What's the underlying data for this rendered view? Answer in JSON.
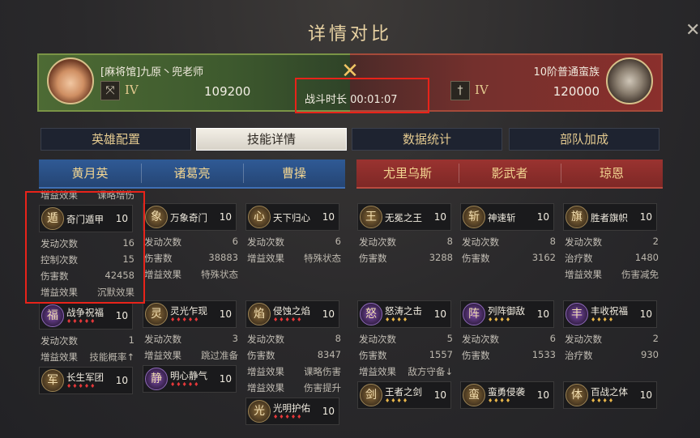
{
  "title": "详情对比",
  "close_icon": "close-icon",
  "battle": {
    "left": {
      "name": "[麻将馆]九原丶兜老师",
      "tier": "IV",
      "power": "109200",
      "tier_icon": "bow-icon"
    },
    "right": {
      "name": "10阶普通蛮族",
      "tier": "IV",
      "power": "120000",
      "tier_icon": "sword-icon"
    },
    "vs_icon": "crossed-swords-icon",
    "duration_label": "战斗时长",
    "duration_value": "00:01:07"
  },
  "tabs": [
    {
      "label": "英雄配置",
      "active": false
    },
    {
      "label": "技能详情",
      "active": true
    },
    {
      "label": "数据统计",
      "active": false
    },
    {
      "label": "部队加成",
      "active": false
    }
  ],
  "heroes_left": [
    "黄月英",
    "诸葛亮",
    "曹操"
  ],
  "heroes_right": [
    "尤里乌斯",
    "影武者",
    "琼恩"
  ],
  "colors": {
    "accent_gold": "#e3c98f",
    "team_blue": "#2f5a95",
    "team_red": "#9a3330",
    "highlight": "#e8231a"
  },
  "columns": [
    {
      "hero": "黄月英",
      "items": [
        {
          "type": "stat",
          "key": "增益效果",
          "val": "课略增伤"
        },
        {
          "type": "skill",
          "name": "奇门遁甲",
          "level": "10",
          "stars": "",
          "icon": "gold",
          "glyph": "遁"
        },
        {
          "type": "stat",
          "key": "发动次数",
          "val": "16"
        },
        {
          "type": "stat",
          "key": "控制次数",
          "val": "15"
        },
        {
          "type": "stat",
          "key": "伤害数",
          "val": "42458"
        },
        {
          "type": "stat",
          "key": "增益效果",
          "val": "沉默效果"
        },
        {
          "type": "skill",
          "name": "战争祝福",
          "level": "10",
          "stars": "♦♦♦♦♦",
          "starColor": "red",
          "icon": "purple",
          "glyph": "福"
        },
        {
          "type": "stat",
          "key": "发动次数",
          "val": "1"
        },
        {
          "type": "stat",
          "key": "增益效果",
          "val": "技能概率↑"
        },
        {
          "type": "skill",
          "name": "长生军团",
          "level": "10",
          "stars": "♦♦♦♦♦",
          "starColor": "red",
          "icon": "gold",
          "glyph": "军"
        }
      ]
    },
    {
      "hero": "诸葛亮",
      "items": [
        {
          "type": "skill",
          "name": "万象奇门",
          "level": "10",
          "stars": "",
          "icon": "gold",
          "glyph": "象",
          "offset": 18
        },
        {
          "type": "stat",
          "key": "发动次数",
          "val": "6"
        },
        {
          "type": "stat",
          "key": "伤害数",
          "val": "38883"
        },
        {
          "type": "stat",
          "key": "增益效果",
          "val": "特殊状态"
        },
        {
          "type": "gap"
        },
        {
          "type": "skill",
          "name": "灵光乍现",
          "level": "10",
          "stars": "♦♦♦♦♦",
          "starColor": "red",
          "icon": "gold",
          "glyph": "灵"
        },
        {
          "type": "stat",
          "key": "发动次数",
          "val": "3"
        },
        {
          "type": "stat",
          "key": "增益效果",
          "val": "跳过准备"
        },
        {
          "type": "skill",
          "name": "明心静气",
          "level": "10",
          "stars": "♦♦♦♦♦",
          "starColor": "red",
          "icon": "purple",
          "glyph": "静"
        }
      ]
    },
    {
      "hero": "曹操",
      "items": [
        {
          "type": "skill",
          "name": "天下归心",
          "level": "10",
          "stars": "",
          "icon": "gold",
          "glyph": "心",
          "offset": 18
        },
        {
          "type": "stat",
          "key": "发动次数",
          "val": "6"
        },
        {
          "type": "stat",
          "key": "增益效果",
          "val": "特殊状态"
        },
        {
          "type": "gap"
        },
        {
          "type": "gap"
        },
        {
          "type": "skill",
          "name": "侵蚀之焰",
          "level": "10",
          "stars": "♦♦♦♦♦",
          "starColor": "red",
          "icon": "gold",
          "glyph": "焰"
        },
        {
          "type": "stat",
          "key": "发动次数",
          "val": "8"
        },
        {
          "type": "stat",
          "key": "伤害数",
          "val": "8347"
        },
        {
          "type": "stat",
          "key": "增益效果",
          "val": "课略伤害"
        },
        {
          "type": "stat",
          "key": "增益效果",
          "val": "伤害提升"
        },
        {
          "type": "skill",
          "name": "光明护佑",
          "level": "10",
          "stars": "♦♦♦♦♦",
          "starColor": "red",
          "icon": "gold",
          "glyph": "光"
        }
      ]
    },
    {
      "hero": "尤里乌斯",
      "items": [
        {
          "type": "skill",
          "name": "无冕之王",
          "level": "10",
          "stars": "",
          "icon": "gold",
          "glyph": "王",
          "offset": 18
        },
        {
          "type": "stat",
          "key": "发动次数",
          "val": "8"
        },
        {
          "type": "stat",
          "key": "伤害数",
          "val": "3288"
        },
        {
          "type": "gap"
        },
        {
          "type": "gap"
        },
        {
          "type": "skill",
          "name": "怒涛之击",
          "level": "10",
          "stars": "♦♦♦♦",
          "starColor": "gold",
          "icon": "purple",
          "glyph": "怒"
        },
        {
          "type": "stat",
          "key": "发动次数",
          "val": "5"
        },
        {
          "type": "stat",
          "key": "伤害数",
          "val": "1557"
        },
        {
          "type": "stat",
          "key": "增益效果",
          "val": "敌方守备↓"
        },
        {
          "type": "skill",
          "name": "王者之剑",
          "level": "10",
          "stars": "♦♦♦♦",
          "starColor": "gold",
          "icon": "gold",
          "glyph": "剑"
        }
      ]
    },
    {
      "hero": "影武者",
      "items": [
        {
          "type": "skill",
          "name": "神速斩",
          "level": "10",
          "stars": "",
          "icon": "gold",
          "glyph": "斩",
          "offset": 18
        },
        {
          "type": "stat",
          "key": "发动次数",
          "val": "8"
        },
        {
          "type": "stat",
          "key": "伤害数",
          "val": "3162"
        },
        {
          "type": "gap"
        },
        {
          "type": "gap"
        },
        {
          "type": "skill",
          "name": "列阵御敌",
          "level": "10",
          "stars": "♦♦♦♦",
          "starColor": "gold",
          "icon": "purple",
          "glyph": "阵"
        },
        {
          "type": "stat",
          "key": "发动次数",
          "val": "6"
        },
        {
          "type": "stat",
          "key": "伤害数",
          "val": "1533"
        },
        {
          "type": "gap"
        },
        {
          "type": "skill",
          "name": "蛮勇侵袭",
          "level": "10",
          "stars": "♦♦♦♦",
          "starColor": "gold",
          "icon": "gold",
          "glyph": "蛮"
        }
      ]
    },
    {
      "hero": "琼恩",
      "items": [
        {
          "type": "skill",
          "name": "胜者旗帜",
          "level": "10",
          "stars": "",
          "icon": "gold",
          "glyph": "旗",
          "offset": 18
        },
        {
          "type": "stat",
          "key": "发动次数",
          "val": "2"
        },
        {
          "type": "stat",
          "key": "治疗数",
          "val": "1480"
        },
        {
          "type": "stat",
          "key": "增益效果",
          "val": "伤害减免"
        },
        {
          "type": "gap"
        },
        {
          "type": "skill",
          "name": "丰收祝福",
          "level": "10",
          "stars": "♦♦♦♦",
          "starColor": "gold",
          "icon": "purple",
          "glyph": "丰"
        },
        {
          "type": "stat",
          "key": "发动次数",
          "val": "2"
        },
        {
          "type": "stat",
          "key": "治疗数",
          "val": "930"
        },
        {
          "type": "gap"
        },
        {
          "type": "skill",
          "name": "百战之体",
          "level": "10",
          "stars": "♦♦♦♦",
          "starColor": "gold",
          "icon": "gold",
          "glyph": "体"
        }
      ]
    }
  ]
}
